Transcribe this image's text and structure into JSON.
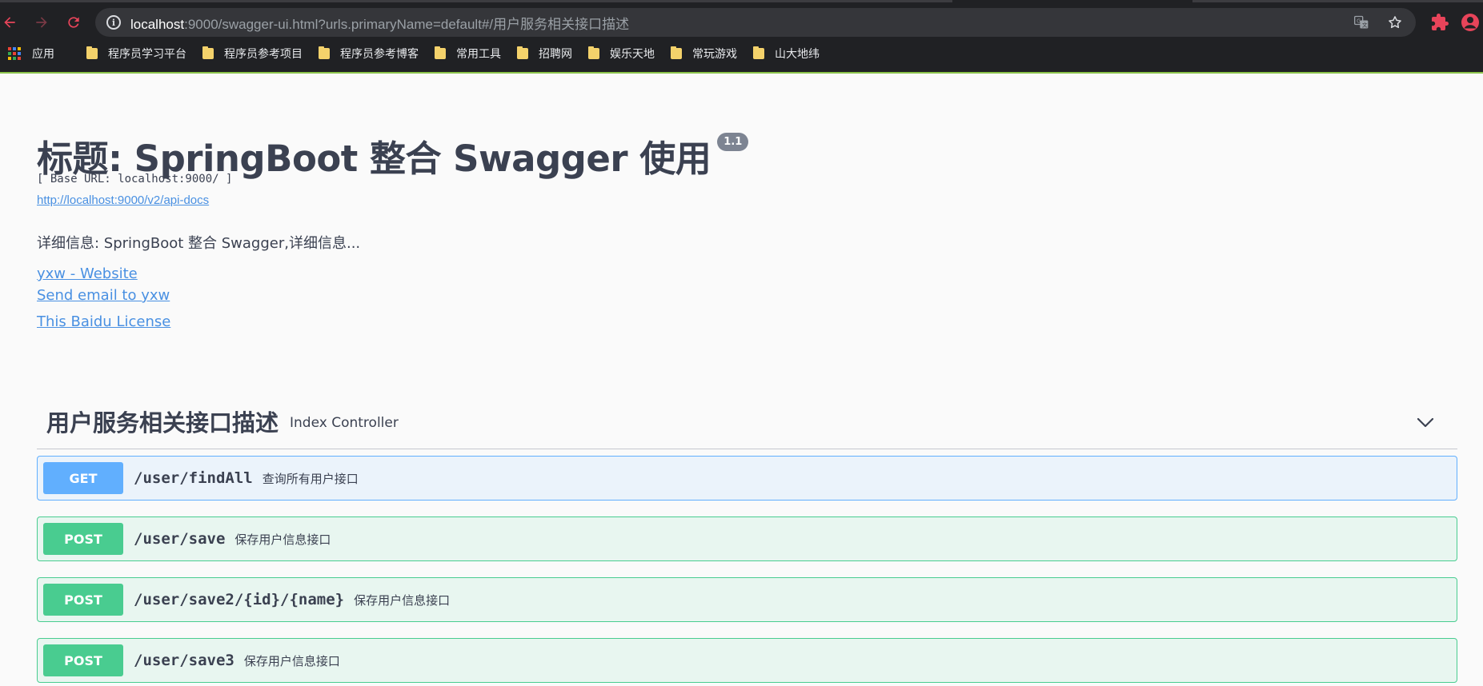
{
  "browser": {
    "url": {
      "host": "localhost",
      "path": ":9000/swagger-ui.html?urls.primaryName=default#/用户服务相关接口描述"
    },
    "icons": {
      "back": "back-arrow-icon",
      "forward": "forward-arrow-icon",
      "reload": "reload-icon",
      "info": "info-icon",
      "translate": "translate-icon",
      "star": "star-icon",
      "extensions": "puzzle-icon",
      "profile": "profile-icon"
    },
    "accent_color": "#e8445a",
    "bookmarks": [
      {
        "label": "应用",
        "type": "apps"
      },
      {
        "label": "程序员学习平台",
        "type": "folder"
      },
      {
        "label": "程序员参考项目",
        "type": "folder"
      },
      {
        "label": "程序员参考博客",
        "type": "folder"
      },
      {
        "label": "常用工具",
        "type": "folder"
      },
      {
        "label": "招聘网",
        "type": "folder"
      },
      {
        "label": "娱乐天地",
        "type": "folder"
      },
      {
        "label": "常玩游戏",
        "type": "folder"
      },
      {
        "label": "山大地纬",
        "type": "folder"
      }
    ]
  },
  "info": {
    "title": "标题: SpringBoot 整合 Swagger 使用",
    "version": "1.1",
    "base_url": "[ Base URL: localhost:9000/ ]",
    "docs_link": "http://localhost:9000/v2/api-docs",
    "description": "详细信息: SpringBoot 整合 Swagger,详细信息...",
    "contact_website": "yxw - Website",
    "contact_email": "Send email to yxw",
    "license": "This Baidu License"
  },
  "tag": {
    "name": "用户服务相关接口描述",
    "description": "Index Controller"
  },
  "operations": [
    {
      "method": "GET",
      "path": "/user/findAll",
      "summary": "查询所有用户接口"
    },
    {
      "method": "POST",
      "path": "/user/save",
      "summary": "保存用户信息接口"
    },
    {
      "method": "POST",
      "path": "/user/save2/{id}/{name}",
      "summary": "保存用户信息接口"
    },
    {
      "method": "POST",
      "path": "/user/save3",
      "summary": "保存用户信息接口"
    }
  ],
  "colors": {
    "get": "#61affe",
    "post": "#49cc90",
    "text": "#3b4151",
    "link": "#4990e2"
  }
}
